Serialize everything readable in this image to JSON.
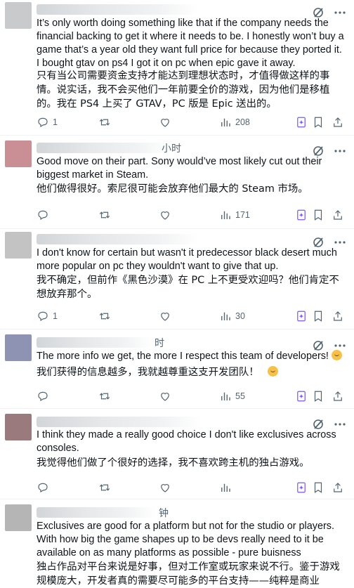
{
  "colors": {
    "text": "#0f1419",
    "muted": "#536471",
    "divider": "#eff3f4",
    "grok_accent": "#7856ff"
  },
  "icons": {
    "grok": "grok-slash-icon",
    "more": "more-dots-icon",
    "reply": "reply-bubble-icon",
    "retweet": "retweet-arrows-icon",
    "like": "heart-icon",
    "views": "views-bar-chart-icon",
    "bookmark": "bookmark-icon",
    "share": "share-upload-icon"
  },
  "tweets": [
    {
      "avatar_color": "#c8cacc",
      "time_suffix": "",
      "en": "It’s only worth doing something like that if the company needs the financial backing to get it where it needs to be. I honestly won’t buy a game that’s a year old they want full price for because they ported it. I bought gtav on ps4 I got it on pc when epic gave it away.",
      "zh": "只有当公司需要资金支持才能达到理想状态时，才值得做这样的事情。说实话，我不会买他们一年前要全价的游戏，因为他们是移植的。我在 PS4 上买了 GTAV，PC 版是 Epic 送出的。",
      "replies": "1",
      "retweets": "",
      "likes": "",
      "views": "208"
    },
    {
      "avatar_color": "#c98f95",
      "time_suffix": "小时",
      "en": "Good move on their part. Sony would’ve most likely cut out their biggest market in Steam.",
      "zh": "他们做得很好。索尼很可能会放弃他们最大的 Steam 市场。",
      "replies": "",
      "retweets": "",
      "likes": "",
      "views": "171"
    },
    {
      "avatar_color": "#c4c3c3",
      "time_suffix": "",
      "en": "I don't know for certain but wasn't it predecessor black desert much more popular on pc they wouldn't want to give that up.",
      "zh": "我不确定，但前作《黑色沙漠》在 PC 上不更受欢迎吗？他们肯定不想放弃那个。",
      "replies": "1",
      "retweets": "",
      "likes": "",
      "views": "30"
    },
    {
      "avatar_color": "#8e93b3",
      "time_suffix": "时",
      "en": "The more info we get, the more I respect this team of developers!",
      "zh": "我们获得的信息越多，我就越尊重这支开发团队！",
      "replies": "",
      "retweets": "",
      "likes": "",
      "views": "55"
    },
    {
      "avatar_color": "#9b7a7e",
      "time_suffix": "",
      "en": "I think they made a really good choice I don't like exclusives across consoles.",
      "zh": "我觉得他们做了个很好的选择，我不喜欢跨主机的独占游戏。",
      "replies": "",
      "retweets": "",
      "likes": "",
      "views": ""
    },
    {
      "avatar_color": "#b5b5b5",
      "time_suffix": "钟",
      "en": "Exclusives are good for a platform but not for the studio or players. With how big the game shapes up to be devs really need to it be available on as many platforms as possible - pure buisness",
      "zh": "独占作品对平台来说是好事，但对工作室或玩家来说不行。鉴于游戏规模庞大，开发者真的需要尽可能多的平台支持——纯粹是商业",
      "replies": "",
      "retweets": "",
      "likes": "",
      "views": ""
    }
  ]
}
